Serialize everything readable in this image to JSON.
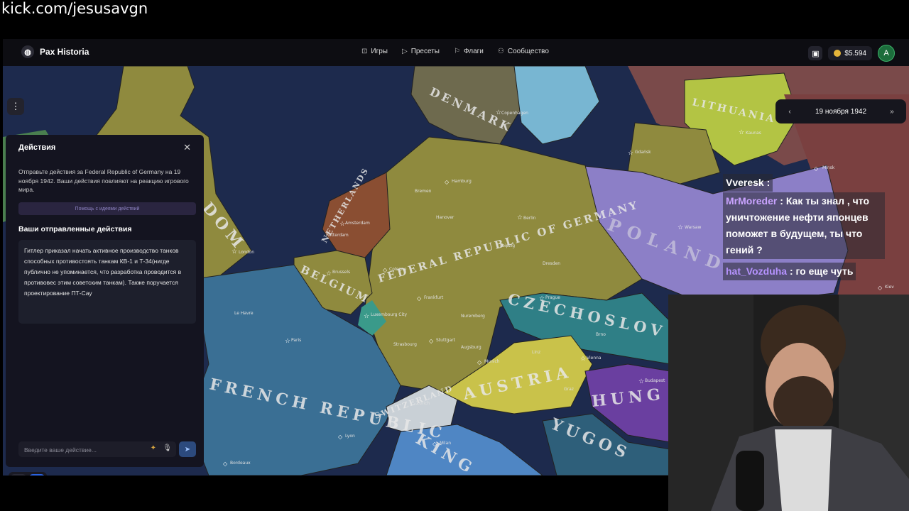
{
  "stream_url": "kick.com/jesusavgn",
  "app": {
    "name": "Pax Historia",
    "nav": [
      {
        "label": "Игры",
        "icon": "gamepad-icon"
      },
      {
        "label": "Пресеты",
        "icon": "play-icon"
      },
      {
        "label": "Флаги",
        "icon": "flag-icon"
      },
      {
        "label": "Сообщество",
        "icon": "users-icon"
      }
    ],
    "balance": "$5.594",
    "avatar_initial": "A"
  },
  "date_nav": {
    "date": "19 ноября 1942"
  },
  "panel": {
    "title": "Действия",
    "description": "Отправьте действия за Federal Republic of Germany на 19 ноября 1942. Ваши действия повлияют на реакцию игрового мира.",
    "help_label": "Помощь с идеями действий",
    "sent_title": "Ваши отправленные действия",
    "sent_action": "Гитлер приказал начать активное производство танков способных противостоять танкам КВ-1 и Т-34(нигде публично не упоминается, что разработка проводится в противовес этим советским танкам). Также поручается проектирование ПТ-Сау",
    "input_placeholder": "Введите ваше действие..."
  },
  "map": {
    "countries": [
      "DENMARK",
      "LITHUANIA",
      "NETHERLANDS",
      "FEDERAL REPUBLIC OF GERMANY",
      "POLAND",
      "BELGIUM",
      "CZECHOSLOV",
      "AUSTRIA",
      "HUNG",
      "SWITZERLAND",
      "FRENCH REPUBLIC",
      "YUGOS",
      "KING",
      "DOM"
    ],
    "cities": [
      "Copenhagen",
      "Kaunas",
      "Minsk",
      "Hamburg",
      "Berlin",
      "Amsterdam",
      "Rotterdam",
      "London",
      "Warsaw",
      "Brussels",
      "Cologne",
      "Frankfurt",
      "Prague",
      "Luxembourg City",
      "Le Havre",
      "Paris",
      "Stuttgart",
      "Munich",
      "Vienna",
      "Budapest",
      "Zurich",
      "Lyon",
      "Milan",
      "Bordeaux",
      "Kiev",
      "Gdańsk",
      "Bremen",
      "Hanover",
      "Leipzig",
      "Dresden",
      "Nuremberg",
      "Strasbourg",
      "Augsburg",
      "Brno",
      "Graz",
      "Linz"
    ]
  },
  "chat": [
    {
      "user": "Vveresk",
      "text": ""
    },
    {
      "user": "MrMoreder",
      "text": "Как ты знал , что уничтожение нефти японцев поможет в будущем, ты что гений ?"
    },
    {
      "user": "hat_Vozduha",
      "text": "го еще чуть"
    }
  ],
  "colors": {
    "germany": "#8f8a3e",
    "poland": "#8c7fc7",
    "lithuania": "#b3c444",
    "czechoslovakia": "#2f7f86",
    "austria": "#c9c24a",
    "netherlands": "#8a4e32",
    "france": "#3a6f94",
    "sea": "#1d2a4d",
    "accent": "#2b62e0"
  }
}
